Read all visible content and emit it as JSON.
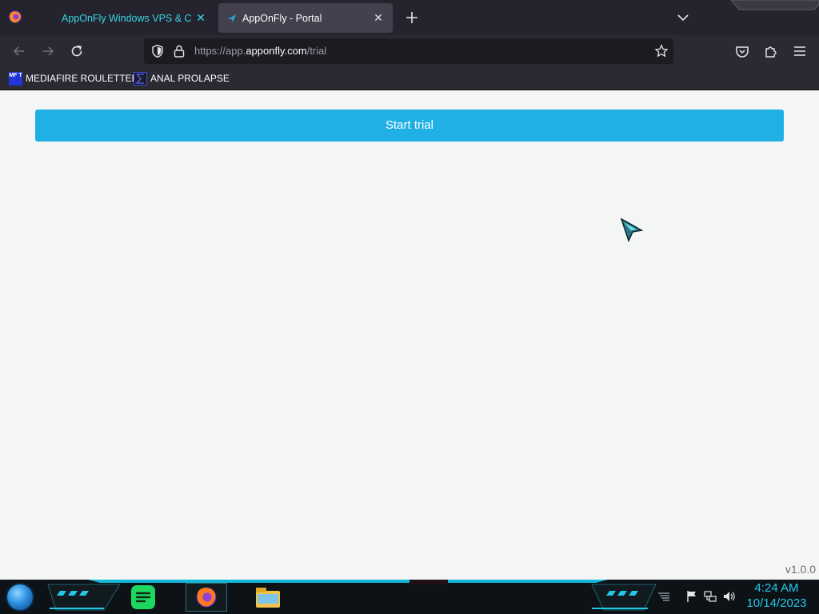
{
  "browser": {
    "tabs": [
      {
        "title": "AppOnFly Windows VPS & Clou",
        "active": false
      },
      {
        "title": "AppOnFly - Portal",
        "active": true
      }
    ],
    "url": {
      "prefix": "https://app.",
      "host": "apponfly.com",
      "path": "/trial"
    },
    "bookmarks": [
      {
        "label": "MEDIAFIRE ROULETTER",
        "icon_text": "MF T"
      },
      {
        "label": "ANAL PROLAPSE"
      }
    ]
  },
  "page": {
    "start_trial_label": "Start trial",
    "version": "v1.0.0"
  },
  "taskbar": {
    "clock_time": "4:24 AM",
    "clock_date": "10/14/2023",
    "apps": [
      "spotify-icon",
      "firefox-icon",
      "file-explorer-icon"
    ]
  },
  "colors": {
    "accent_button": "#20b0e6",
    "tab_text_inactive": "#34d8e3",
    "clock": "#22c8e8",
    "page_bg": "#f4f5f5",
    "chrome_bg": "#2b2a33"
  }
}
